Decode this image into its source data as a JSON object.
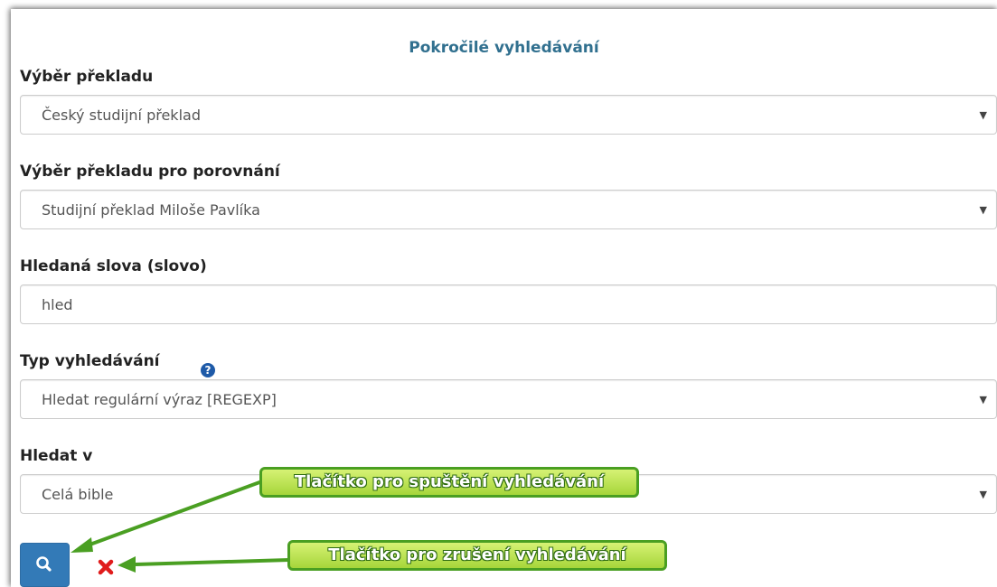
{
  "panel": {
    "title": "Pokročilé vyhledávání"
  },
  "form": {
    "translation": {
      "label": "Výběr překladu",
      "value": "Český studijní překlad"
    },
    "compare": {
      "label": "Výběr překladu pro porovnání",
      "value": "Studijní překlad Miloše Pavlíka"
    },
    "words": {
      "label": "Hledaná slova (slovo)",
      "value": "hled"
    },
    "type": {
      "label": "Typ vyhledávání",
      "value": "Hledat regulární výraz [REGEXP]"
    },
    "scope": {
      "label": "Hledat v",
      "value": "Celá bible"
    }
  },
  "annotations": {
    "search": "Tlačítko pro spuštění vyhledávání",
    "cancel": "Tlačítko pro zrušení vyhledávání"
  },
  "colors": {
    "title": "#31708f",
    "primary_button": "#337ab7",
    "cancel_icon": "#e01b1b",
    "callout_border": "#4a9f22"
  },
  "icons": {
    "caret": "triangle-down-icon",
    "help": "question-circle-icon",
    "search": "magnifier-icon",
    "cancel": "x-icon"
  }
}
